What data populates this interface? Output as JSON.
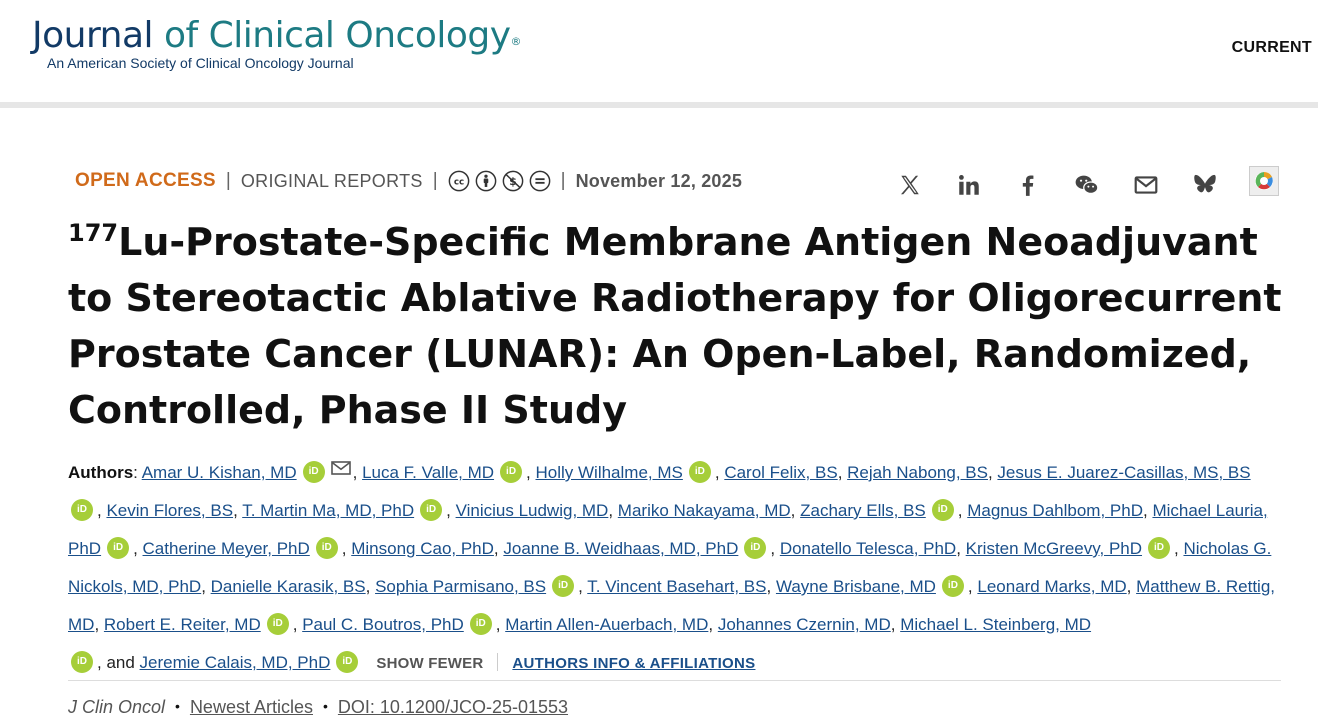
{
  "header": {
    "logo_journal": "Journal",
    "logo_rest": "of Clinical Oncology",
    "logo_reg": "®",
    "logo_subtitle": "An American Society of Clinical Oncology Journal",
    "nav_current": "CURRENT"
  },
  "meta": {
    "open_access": "OPEN ACCESS",
    "separator": "|",
    "report_type": "ORIGINAL REPORTS",
    "license_icons": [
      "cc-icon",
      "by-icon",
      "nc-icon",
      "nd-icon"
    ],
    "date": "November 12, 2025"
  },
  "share": {
    "icons": [
      "x-icon",
      "linkedin-icon",
      "facebook-icon",
      "wechat-icon",
      "email-icon",
      "bluesky-icon",
      "altmetric-badge"
    ]
  },
  "article": {
    "title_sup": "177",
    "title_main": "Lu-Prostate-Specific Membrane Antigen Neoadjuvant to Stereotactic Ablative Radiotherapy for Oligorecurrent Prostate Cancer (LUNAR): An Open-Label, Randomized, Controlled, Phase II Study"
  },
  "authors": {
    "label": "Authors",
    "list": [
      "Amar U. Kishan, MD",
      "Luca F. Valle, MD",
      "Holly Wilhalme, MS",
      "Carol Felix, BS",
      "Rejah Nabong, BS",
      "Jesus E. Juarez-Casillas, MS, BS",
      "Kevin Flores, BS",
      "T. Martin Ma, MD, PhD",
      "Vinicius Ludwig, MD",
      "Mariko Nakayama, MD",
      "Zachary Ells, BS",
      "Magnus Dahlbom, PhD",
      "Michael Lauria, PhD",
      "Catherine Meyer, PhD",
      "Minsong Cao, PhD",
      "Joanne B. Weidhaas, MD, PhD",
      "Donatello Telesca, PhD",
      "Kristen McGreevy, PhD",
      "Nicholas G. Nickols, MD, PhD",
      "Danielle Karasik, BS",
      "Sophia Parmisano, BS",
      "T. Vincent Basehart, BS",
      "Wayne Brisbane, MD",
      "Leonard Marks, MD",
      "Matthew B. Rettig, MD",
      "Robert E. Reiter, MD",
      "Paul C. Boutros, PhD",
      "Martin Allen-Auerbach, MD",
      "Johannes Czernin, MD",
      "Michael L. Steinberg, MD",
      "Jeremie Calais, MD, PhD"
    ],
    "orcid_label": "iD",
    "and_text": ", and",
    "show_fewer": "SHOW FEWER",
    "affiliations": "AUTHORS INFO & AFFILIATIONS"
  },
  "citation": {
    "journal": "J Clin Oncol",
    "section": "Newest Articles",
    "doi": "DOI: 10.1200/JCO-25-01553",
    "bullet": "•"
  }
}
